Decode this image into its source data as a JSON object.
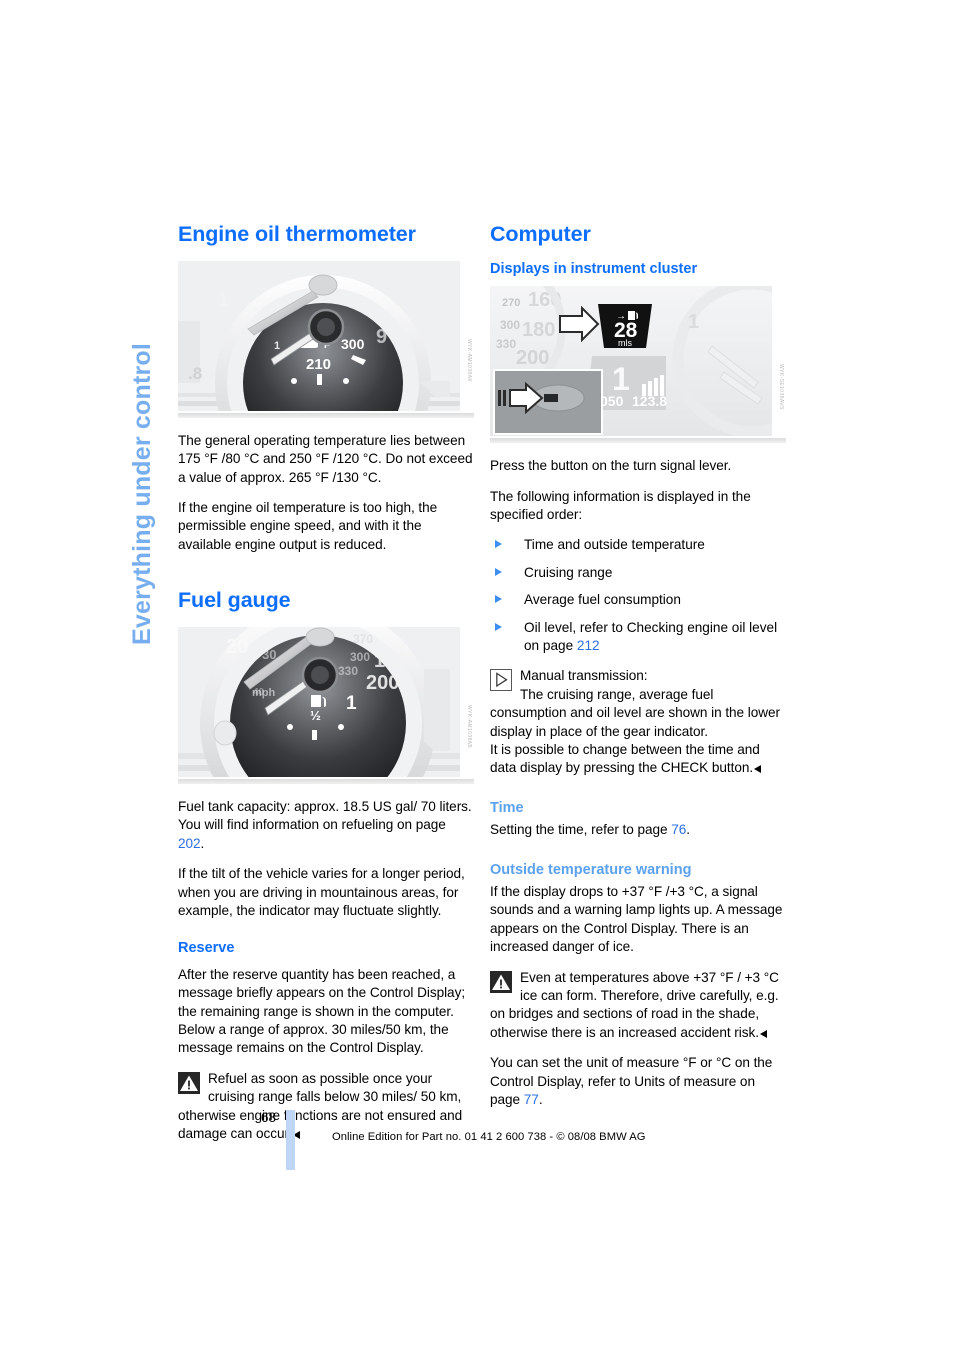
{
  "chapter_tab": "Everything under control",
  "left_column": {
    "heading_1": "Engine oil thermometer",
    "figure_1": {
      "code": "WYK-AM1038AK",
      "labels": [
        "1",
        "8",
        "9",
        "300",
        "210",
        "°F",
        ".8"
      ]
    },
    "para_1": "The general operating temperature lies between 175 °F /80 °C and 250 °F /120 °C. Do not exceed a value of approx. 265 °F /130 °C.",
    "para_2": "If the engine oil temperature is too high, the permissible engine speed, and with it the available engine output is reduced.",
    "heading_2": "Fuel gauge",
    "figure_2": {
      "code": "WYK-AM1038AB",
      "labels": [
        "20",
        "30",
        "180",
        "200",
        "330",
        "370",
        "mph",
        "1",
        "½",
        "1"
      ]
    },
    "para_3_a": "Fuel tank capacity: approx. 18.5 US gal/ 70 liters. You will find information on refueling on page ",
    "para_3_ref": "202",
    "para_3_b": ".",
    "para_4": "If the tilt of the vehicle varies for a longer period, when you are driving in mountainous areas, for example, the indicator may fluctuate slightly.",
    "heading_3": "Reserve",
    "para_5": "After the reserve quantity has been reached, a message briefly appears on the Control Display; the remaining range is shown in the computer. Below a range of approx. 30 miles/50 km, the message remains on the Control Display.",
    "warning_1": "Refuel as soon as possible once your cruising range falls below 30 miles/ 50 km, otherwise engine functions are not ensured and damage can occur."
  },
  "right_column": {
    "heading_1": "Computer",
    "heading_2": "Displays in instrument cluster",
    "figure_1": {
      "code": "WYK-SE1038AVS",
      "labels": [
        "160",
        "180",
        "200",
        "270",
        "300",
        "330",
        "28",
        "mls",
        "1",
        "050",
        "123.8"
      ]
    },
    "para_1": "Press the button on the turn signal lever.",
    "para_2": "The following information is displayed in the specified order:",
    "bullets": [
      {
        "text": "Time and outside temperature"
      },
      {
        "text": "Cruising range"
      },
      {
        "text": "Average fuel consumption"
      },
      {
        "text": "Oil level, refer to Checking engine oil level on page ",
        "ref": "212"
      }
    ],
    "note_1_line1": "Manual transmission:",
    "note_1_line2": "The cruising range, average fuel consumption and oil level are shown in the lower display in place of the gear indicator.",
    "note_1_line3": "It is possible to change between the time and data display by pressing the CHECK button.",
    "heading_time": "Time",
    "para_time_a": "Setting the time, refer to page ",
    "para_time_ref": "76",
    "para_time_b": ".",
    "heading_temp_warning": "Outside temperature warning",
    "para_temp": "If the display drops to +37 °F /+3 °C, a signal sounds and a warning lamp lights up. A message appears on the Control Display. There is an increased danger of ice.",
    "warning_2": "Even at temperatures above +37 °F / +3 °C ice can form. Therefore, drive carefully, e.g. on bridges and sections of road in the shade, otherwise there is an increased accident risk.",
    "para_units_a": "You can set the unit of measure °F  or °C on the Control Display, refer to Units of measure on page ",
    "para_units_ref": "77",
    "para_units_b": "."
  },
  "footer": {
    "page_number": "68",
    "text": "Online Edition for Part no. 01 41 2 600 738 - © 08/08 BMW AG"
  },
  "colors": {
    "heading_blue": "#0d6efd",
    "subtle_blue": "#5ba1ee",
    "tab_blue": "#77aeef",
    "page_ref": "#2b6fe0",
    "footer_bar": "#bfd7f5"
  }
}
